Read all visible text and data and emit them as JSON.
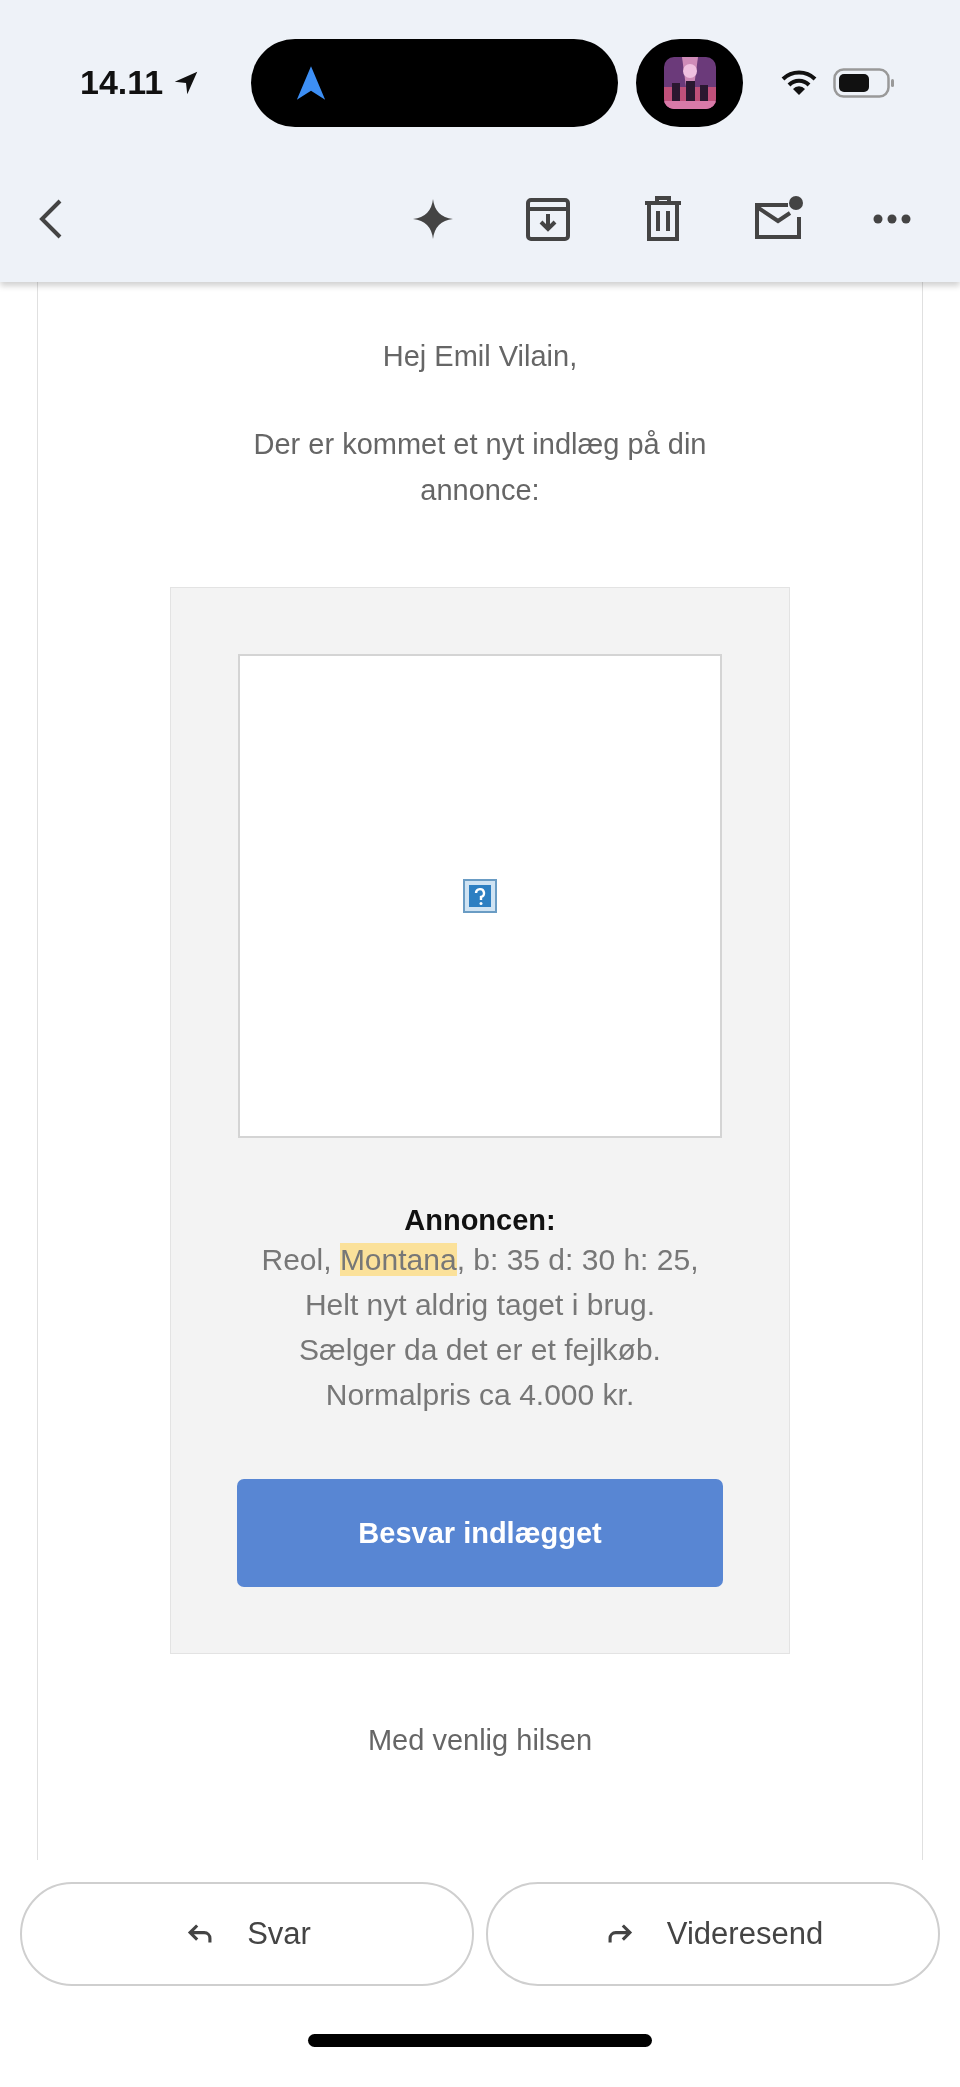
{
  "status_bar": {
    "time": "14.11"
  },
  "email": {
    "greeting": "Hej Emil Vilain,",
    "intro": "Der er kommet et nyt indlæg på din annonce:",
    "listing": {
      "image": {
        "kind": "broken"
      },
      "heading": "Annoncen:",
      "description_lines": [
        [
          {
            "text": "Reol, ",
            "highlighted": false
          },
          {
            "text": "Montana",
            "highlighted": true
          },
          {
            "text": ", b: 35 d: 30 h: 25,",
            "highlighted": false
          }
        ],
        [
          {
            "text": "Helt nyt aldrig taget i brug.",
            "highlighted": false
          }
        ],
        [
          {
            "text": "Sælger da det er et fejlkøb.",
            "highlighted": false
          }
        ],
        [
          {
            "text": "Normalpris ca 4.000 kr.",
            "highlighted": false
          }
        ]
      ],
      "button": "Besvar indlægget"
    },
    "closing": "Med venlig hilsen"
  },
  "actions": [
    {
      "label": "Svar",
      "kind": "reply"
    },
    {
      "label": "Videresend",
      "kind": "forward"
    }
  ]
}
